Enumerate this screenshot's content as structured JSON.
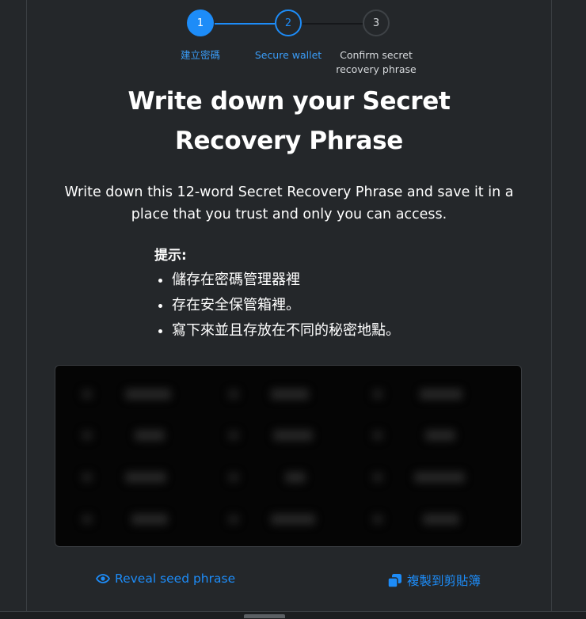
{
  "stepper": {
    "steps": [
      {
        "number": "1",
        "label": "建立密碼"
      },
      {
        "number": "2",
        "label": "Secure wallet"
      },
      {
        "number": "3",
        "label": "Confirm secret recovery phrase"
      }
    ]
  },
  "title": "Write down your Secret Recovery Phrase",
  "intro": "Write down this 12-word Secret Recovery Phrase and save it in a place that you trust and only you can access.",
  "tips": {
    "title": "提示:",
    "items": [
      "儲存在密碼管理器裡",
      "存在安全保管箱裡。",
      "寫下來並且存放在不同的秘密地點。"
    ]
  },
  "actions": {
    "reveal": "Reveal seed phrase",
    "copy": "複製到剪貼簿"
  },
  "colors": {
    "accent": "#1d8cf8",
    "background": "#24272a",
    "phrase_box": "#050505"
  }
}
